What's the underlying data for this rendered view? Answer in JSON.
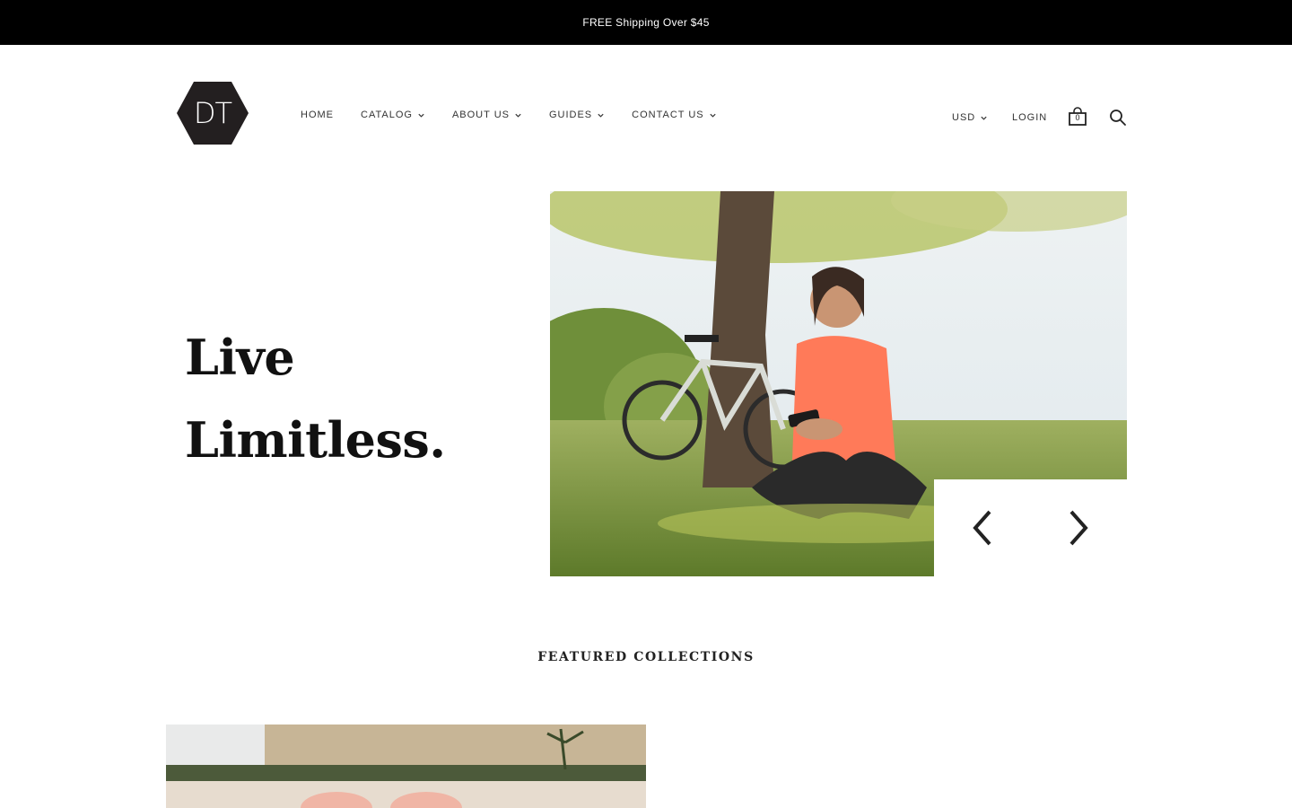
{
  "announcement": {
    "text": "FREE Shipping Over $45"
  },
  "logo": {
    "text": "DT",
    "color": "#231f20"
  },
  "nav": {
    "items": [
      {
        "label": "HOME",
        "dropdown": false
      },
      {
        "label": "CATALOG",
        "dropdown": true
      },
      {
        "label": "ABOUT US",
        "dropdown": true
      },
      {
        "label": "GUIDES",
        "dropdown": true
      },
      {
        "label": "CONTACT US",
        "dropdown": true
      }
    ]
  },
  "utils": {
    "currency": "USD",
    "login": "LOGIN",
    "cart_count": "0",
    "cart_icon": "shopping-bag-icon",
    "search_icon": "search-icon"
  },
  "hero": {
    "heading_line1": "Live",
    "heading_line2": "Limitless.",
    "image_alt": "woman-sitting-on-grass-with-phone-and-bicycle"
  },
  "slider": {
    "prev_icon": "chevron-left-icon",
    "next_icon": "chevron-right-icon"
  },
  "featured": {
    "title": "FEATURED COLLECTIONS"
  },
  "colors": {
    "announcement_bg": "#000000",
    "text": "#222222",
    "accent_shirt": "#ff7a59"
  }
}
